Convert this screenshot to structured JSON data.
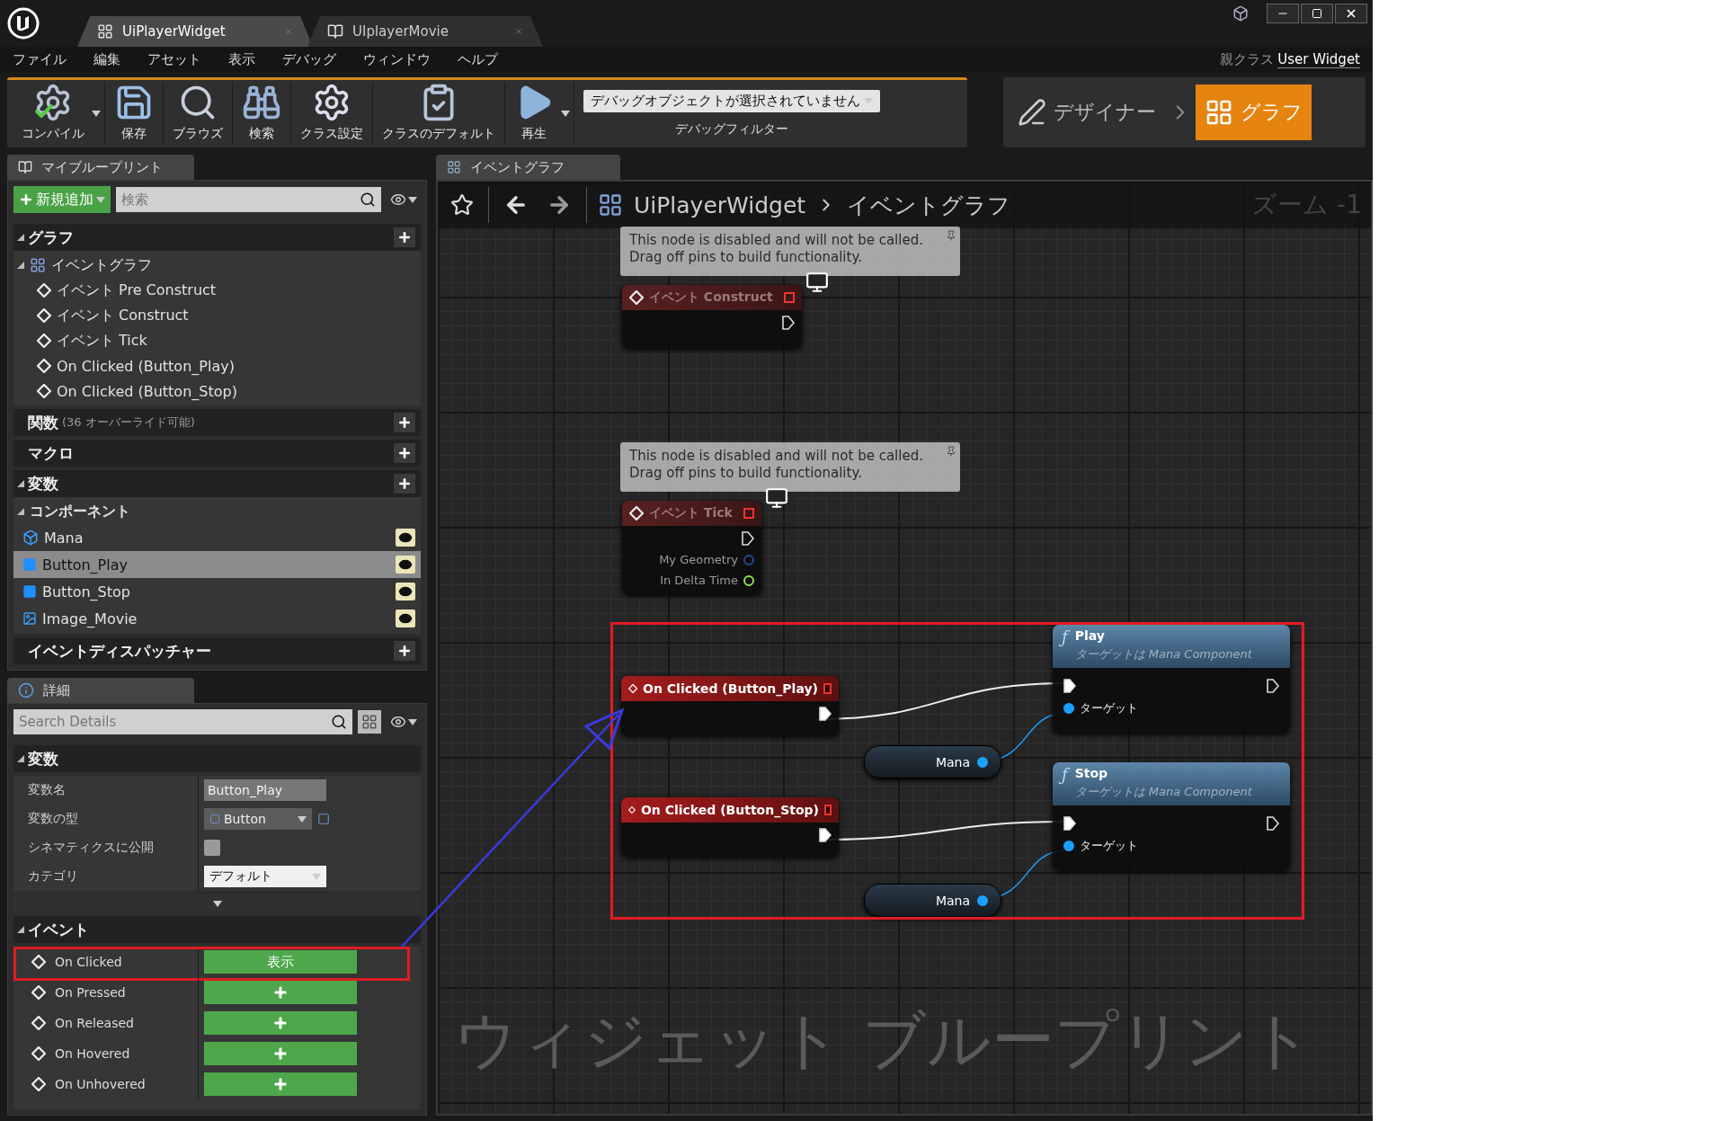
{
  "window": {
    "tabs": [
      {
        "label": "UiPlayerWidget",
        "selected": true
      },
      {
        "label": "UIplayerMovie",
        "selected": false
      }
    ]
  },
  "menu": [
    "ファイル",
    "編集",
    "アセット",
    "表示",
    "デバッグ",
    "ウィンドウ",
    "ヘルプ"
  ],
  "parent_class": {
    "label": "親クラス",
    "value": "User Widget"
  },
  "toolbar": [
    {
      "label": "コンパイル",
      "kind": "compile",
      "menu": true
    },
    {
      "label": "保存",
      "kind": "save",
      "menu": false
    },
    {
      "label": "ブラウズ",
      "kind": "browse",
      "menu": false
    },
    {
      "label": "検索",
      "kind": "find",
      "menu": false
    },
    {
      "label": "クラス設定",
      "kind": "settings",
      "menu": false
    },
    {
      "label": "クラスのデフォルト",
      "kind": "defaults",
      "menu": false
    },
    {
      "label": "再生",
      "kind": "play",
      "menu": true
    }
  ],
  "debug_filter": {
    "value": "デバッグオブジェクトが選択されていません",
    "label": "デバッグフィルター"
  },
  "modes": [
    {
      "label": "デザイナー",
      "kind": "designer",
      "selected": false
    },
    {
      "label": "グラフ",
      "kind": "graph",
      "selected": true
    }
  ],
  "my_blueprint": {
    "tab": "マイブループリント",
    "add_button": "新規追加",
    "search": {
      "placeholder": "検索"
    },
    "sections": [
      {
        "title": "グラフ",
        "expanded": true,
        "children": [
          {
            "label": "イベントグラフ",
            "kind": "graph",
            "expanded": true,
            "children": [
              {
                "label": "イベント Pre Construct",
                "kind": "event"
              },
              {
                "label": "イベント Construct",
                "kind": "event"
              },
              {
                "label": "イベント Tick",
                "kind": "event"
              },
              {
                "label": "On Clicked (Button_Play)",
                "kind": "event"
              },
              {
                "label": "On Clicked (Button_Stop)",
                "kind": "event"
              }
            ]
          }
        ]
      },
      {
        "title": "関数",
        "note": "(36 オーバーライド可能)",
        "expanded": false
      },
      {
        "title": "マクロ",
        "expanded": false
      },
      {
        "title": "変数",
        "expanded": true,
        "children": [
          {
            "label": "コンポーネント",
            "kind": "category",
            "expanded": true,
            "children": [
              {
                "label": "Mana",
                "kind": "component",
                "selected": false
              },
              {
                "label": "Button_Play",
                "kind": "button",
                "selected": true
              },
              {
                "label": "Button_Stop",
                "kind": "button",
                "selected": false
              },
              {
                "label": "Image_Movie",
                "kind": "image",
                "selected": false
              }
            ]
          }
        ]
      },
      {
        "title": "イベントディスパッチャー",
        "expanded": false
      }
    ]
  },
  "details": {
    "tab": "詳細",
    "search": {
      "placeholder": "Search Details"
    },
    "variables": {
      "title": "変数",
      "expanded": true,
      "rows": [
        {
          "label": "変数名",
          "kind": "text",
          "value": "Button_Play"
        },
        {
          "label": "変数の型",
          "kind": "type",
          "value": "Button"
        },
        {
          "label": "シネマティクスに公開",
          "kind": "checkbox",
          "checked": false
        },
        {
          "label": "カテゴリ",
          "kind": "dropdown",
          "value": "デフォルト"
        }
      ]
    },
    "events": {
      "title": "イベント",
      "expanded": true,
      "rows": [
        {
          "label": "On Clicked",
          "action": "表示",
          "highlighted": true
        },
        {
          "label": "On Pressed",
          "highlighted": false
        },
        {
          "label": "On Released",
          "highlighted": false
        },
        {
          "label": "On Hovered",
          "highlighted": false
        },
        {
          "label": "On Unhovered",
          "highlighted": false
        }
      ]
    }
  },
  "graph": {
    "tab": "イベントグラフ",
    "breadcrumb": [
      "UiPlayerWidget",
      "イベントグラフ"
    ],
    "zoom": "ズーム -1",
    "label": "ウィジェット ブループリント",
    "nodes": [
      {
        "kind": "comment",
        "text": "This node is disabled and will not be called.\nDrag off pins to build functionality."
      },
      {
        "kind": "event",
        "title": "イベント Construct",
        "disabled": true
      },
      {
        "kind": "comment",
        "text": "This node is disabled and will not be called.\nDrag off pins to build functionality."
      },
      {
        "kind": "event",
        "title": "イベント Tick",
        "disabled": true,
        "pins": [
          {
            "label": "My Geometry",
            "kind": "struct"
          },
          {
            "label": "In Delta Time",
            "kind": "float"
          }
        ]
      },
      {
        "kind": "event",
        "title": "On Clicked (Button_Play)",
        "disabled": false
      },
      {
        "kind": "function",
        "icon": "ƒ",
        "title": "Play",
        "subtitle": "ターゲットは Mana Component",
        "pin": "ターゲット"
      },
      {
        "kind": "variable",
        "label": "Mana"
      },
      {
        "kind": "event",
        "title": "On Clicked (Button_Stop)",
        "disabled": false
      },
      {
        "kind": "function",
        "icon": "ƒ",
        "title": "Stop",
        "subtitle": "ターゲットは Mana Component",
        "pin": "ターゲット"
      },
      {
        "kind": "variable",
        "label": "Mana"
      }
    ]
  }
}
